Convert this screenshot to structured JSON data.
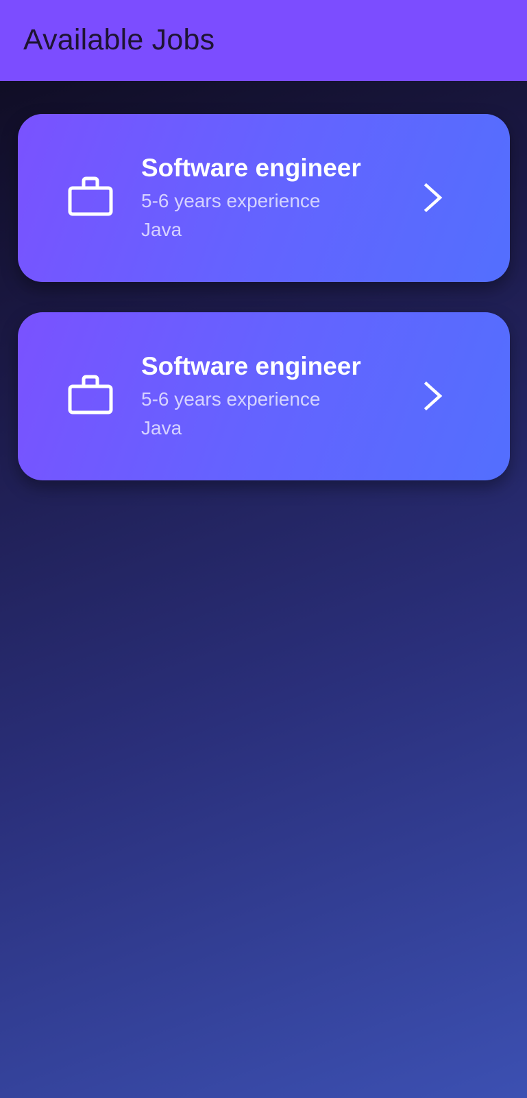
{
  "app_bar": {
    "title": "Available Jobs"
  },
  "jobs": [
    {
      "title": "Software engineer",
      "experience": "5-6 years experience",
      "skill": "Java",
      "icon": "briefcase-icon",
      "action_icon": "chevron-right-icon"
    },
    {
      "title": "Software engineer",
      "experience": "5-6 years experience",
      "skill": "Java",
      "icon": "briefcase-icon",
      "action_icon": "chevron-right-icon"
    }
  ],
  "colors": {
    "app_bar": "#7c4dff",
    "card_start": "#7a52ff",
    "card_end": "#536ffe",
    "background_top": "#0d0a1c",
    "background_bottom": "#3c50b2"
  }
}
